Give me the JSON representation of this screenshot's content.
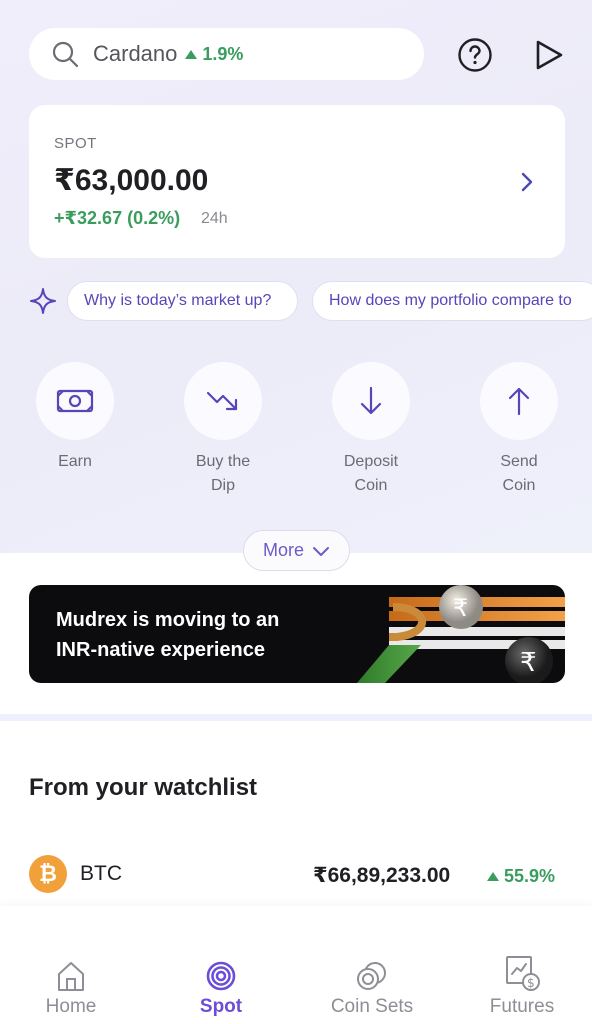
{
  "search": {
    "coin": "Cardano",
    "change": "1.9%"
  },
  "spot": {
    "label": "SPOT",
    "price": "₹63,000.00",
    "change": "+₹32.67 (0.2%)",
    "period": "24h"
  },
  "ai_chips": [
    "Why is today’s market up?",
    "How does my portfolio compare to"
  ],
  "actions": [
    {
      "line1": "Earn",
      "line2": "",
      "icon": "money-icon"
    },
    {
      "line1": "Buy the",
      "line2": "Dip",
      "icon": "trend-down-icon"
    },
    {
      "line1": "Deposit",
      "line2": "Coin",
      "icon": "arrow-down-icon"
    },
    {
      "line1": "Send",
      "line2": "Coin",
      "icon": "arrow-up-icon"
    }
  ],
  "more_label": "More",
  "banner": {
    "line1": "Mudrex is moving to an",
    "line2": "INR-native experience"
  },
  "watchlist": {
    "title": "From your watchlist",
    "items": [
      {
        "symbol": "BTC",
        "price": "₹66,89,233.00",
        "change": "55.9%"
      }
    ]
  },
  "nav": [
    {
      "label": "Home",
      "icon": "home-icon",
      "active": false
    },
    {
      "label": "Spot",
      "icon": "spot-icon",
      "active": true
    },
    {
      "label": "Coin Sets",
      "icon": "coin-sets-icon",
      "active": false
    },
    {
      "label": "Futures",
      "icon": "futures-icon",
      "active": false
    }
  ],
  "colors": {
    "accent": "#6c4ed6",
    "positive": "#3a9d5d",
    "bitcoin": "#f2a03a"
  }
}
